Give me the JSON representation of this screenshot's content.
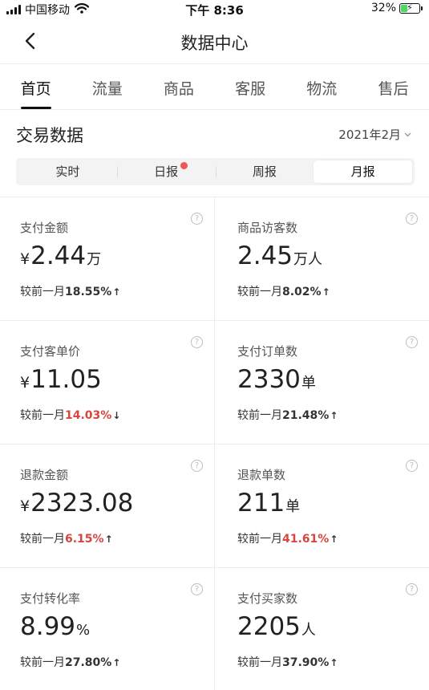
{
  "status_bar": {
    "carrier": "中国移动",
    "time": "下午 8:36",
    "battery": "32%",
    "battery_level": 0.32
  },
  "nav": {
    "title": "数据中心"
  },
  "tabs": [
    {
      "label": "首页",
      "active": true
    },
    {
      "label": "流量",
      "active": false
    },
    {
      "label": "商品",
      "active": false
    },
    {
      "label": "客服",
      "active": false
    },
    {
      "label": "物流",
      "active": false
    },
    {
      "label": "售后",
      "active": false
    }
  ],
  "section": {
    "title": "交易数据",
    "month": "2021年2月"
  },
  "segments": [
    {
      "label": "实时",
      "active": false,
      "dot": false
    },
    {
      "label": "日报",
      "active": false,
      "dot": true
    },
    {
      "label": "周报",
      "active": false,
      "dot": false
    },
    {
      "label": "月报",
      "active": true,
      "dot": false
    }
  ],
  "compare_prefix": "较前一月",
  "metrics": [
    {
      "label": "支付金额",
      "prefix": "¥",
      "value": "2.44",
      "unit": "万",
      "change": "18.55%",
      "direction": "up",
      "highlight": false
    },
    {
      "label": "商品访客数",
      "prefix": "",
      "value": "2.45",
      "unit": "万人",
      "change": "8.02%",
      "direction": "up",
      "highlight": false
    },
    {
      "label": "支付客单价",
      "prefix": "¥",
      "value": "11.05",
      "unit": "",
      "change": "14.03%",
      "direction": "down",
      "highlight": true
    },
    {
      "label": "支付订单数",
      "prefix": "",
      "value": "2330",
      "unit": "单",
      "change": "21.48%",
      "direction": "up",
      "highlight": false
    },
    {
      "label": "退款金额",
      "prefix": "¥",
      "value": "2323.08",
      "unit": "",
      "change": "6.15%",
      "direction": "up",
      "highlight": true
    },
    {
      "label": "退款单数",
      "prefix": "",
      "value": "211",
      "unit": "单",
      "change": "41.61%",
      "direction": "up",
      "highlight": true
    },
    {
      "label": "支付转化率",
      "prefix": "",
      "value": "8.99",
      "unit": "%",
      "change": "27.80%",
      "direction": "up",
      "highlight": false
    },
    {
      "label": "支付买家数",
      "prefix": "",
      "value": "2205",
      "unit": "人",
      "change": "37.90%",
      "direction": "up",
      "highlight": false
    }
  ],
  "colors": {
    "accent_red": "#d6453e",
    "dot_red": "#f15656",
    "battery_green": "#4cd964"
  }
}
